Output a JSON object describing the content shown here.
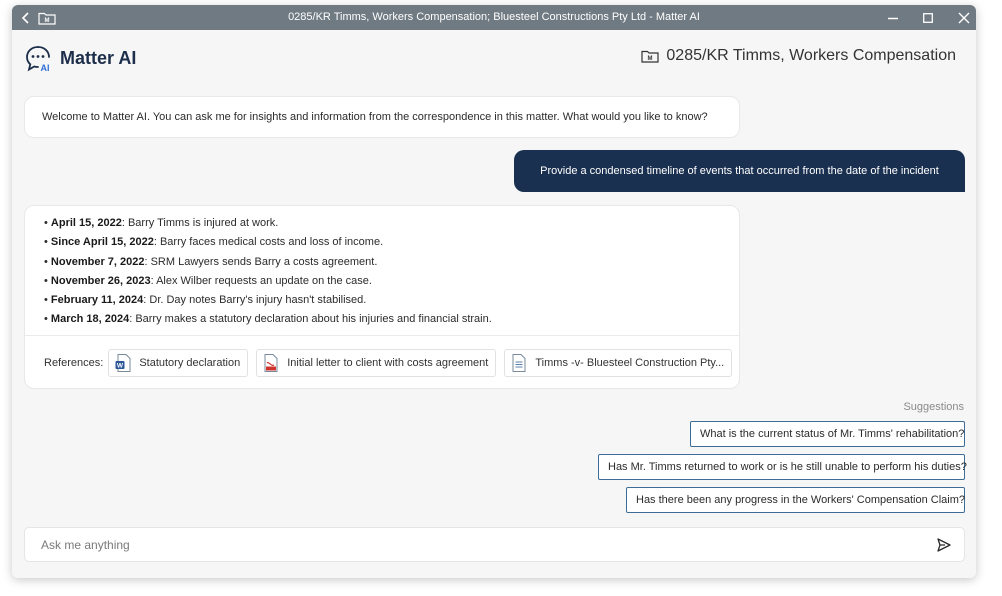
{
  "window": {
    "title": "0285/KR Timms, Workers Compensation; Bluesteel Constructions Pty Ltd - Matter AI"
  },
  "header": {
    "brand": "Matter AI",
    "logo_sub": "AI",
    "matter_title": "0285/KR Timms, Workers Compensation"
  },
  "chat": {
    "welcome": "Welcome to Matter AI. You can ask me for insights and information from the correspondence in this matter. What would you like to know?",
    "user_message": "Provide a condensed timeline of events that occurred from the date of the incident",
    "timeline": [
      {
        "date": "April 15, 2022",
        "text": ": Barry Timms is injured at work."
      },
      {
        "date": "Since April 15, 2022",
        "text": ": Barry faces medical costs and loss of income."
      },
      {
        "date": "November 7, 2022",
        "text": ": SRM Lawyers sends Barry a costs agreement."
      },
      {
        "date": "November 26, 2023",
        "text": ": Alex Wilber requests an update on the case."
      },
      {
        "date": "February 11, 2024",
        "text": ": Dr. Day notes Barry's injury hasn't stabilised."
      },
      {
        "date": "March 18, 2024",
        "text": ": Barry makes a statutory declaration about his injuries and financial strain."
      }
    ],
    "references_label": "References:",
    "references": [
      {
        "label": "Statutory declaration",
        "icon": "word-doc-icon"
      },
      {
        "label": "Initial letter to client with costs agreement",
        "icon": "pdf-doc-icon"
      },
      {
        "label": "Timms -v- Bluesteel Construction Pty...",
        "icon": "text-doc-icon"
      }
    ]
  },
  "suggestions": {
    "label": "Suggestions",
    "items": [
      "What is the current status of Mr. Timms' rehabilitation?",
      "Has Mr. Timms returned to work or is he still unable to perform his duties?",
      "Has there been any progress in the Workers' Compensation Claim?"
    ]
  },
  "input": {
    "placeholder": "Ask me anything",
    "value": ""
  },
  "colors": {
    "titlebar": "#707a82",
    "brand_navy": "#1d2e4a",
    "user_bubble": "#1a3050",
    "suggestion_border": "#3d6c97",
    "logo_accent": "#2f6fd6"
  }
}
